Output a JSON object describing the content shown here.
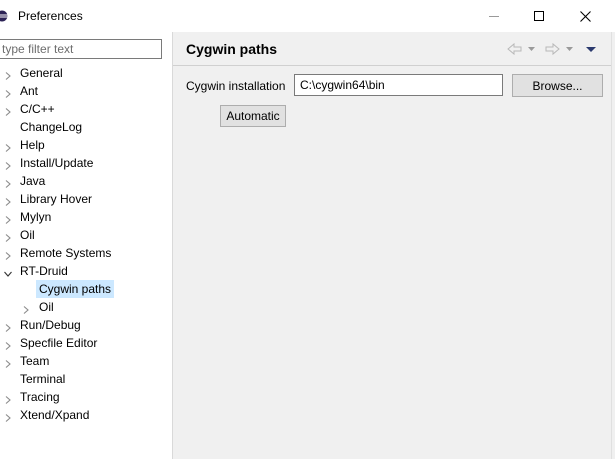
{
  "window": {
    "title": "Preferences",
    "minimize_icon": "minimize-icon",
    "maximize_icon": "maximize-icon",
    "close_icon": "close-icon"
  },
  "filter": {
    "placeholder": "type filter text",
    "value": ""
  },
  "tree": {
    "items": [
      {
        "label": "General",
        "expander": "collapsed",
        "selected": false
      },
      {
        "label": "Ant",
        "expander": "collapsed",
        "selected": false
      },
      {
        "label": "C/C++",
        "expander": "collapsed",
        "selected": false
      },
      {
        "label": "ChangeLog",
        "expander": "none",
        "selected": false
      },
      {
        "label": "Help",
        "expander": "collapsed",
        "selected": false
      },
      {
        "label": "Install/Update",
        "expander": "collapsed",
        "selected": false
      },
      {
        "label": "Java",
        "expander": "collapsed",
        "selected": false
      },
      {
        "label": "Library Hover",
        "expander": "collapsed",
        "selected": false
      },
      {
        "label": "Mylyn",
        "expander": "collapsed",
        "selected": false
      },
      {
        "label": "Oil",
        "expander": "collapsed",
        "selected": false
      },
      {
        "label": "Remote Systems",
        "expander": "collapsed",
        "selected": false
      },
      {
        "label": "RT-Druid",
        "expander": "expanded",
        "selected": false
      },
      {
        "label": "Cygwin paths",
        "expander": "none",
        "selected": true
      },
      {
        "label": "Oil",
        "expander": "collapsed",
        "selected": false
      },
      {
        "label": "Run/Debug",
        "expander": "collapsed",
        "selected": false
      },
      {
        "label": "Specfile Editor",
        "expander": "collapsed",
        "selected": false
      },
      {
        "label": "Team",
        "expander": "collapsed",
        "selected": false
      },
      {
        "label": "Terminal",
        "expander": "none",
        "selected": false
      },
      {
        "label": "Tracing",
        "expander": "collapsed",
        "selected": false
      },
      {
        "label": "Xtend/Xpand",
        "expander": "collapsed",
        "selected": false
      }
    ]
  },
  "page": {
    "title": "Cygwin paths",
    "nav_icons": [
      "back-arrow-icon",
      "back-dropdown-icon",
      "forward-arrow-icon",
      "forward-dropdown-icon",
      "view-menu-icon"
    ],
    "field_label": "Cygwin installation",
    "path_value": "C:\\cygwin64\\bin",
    "browse_label": "Browse...",
    "automatic_label": "Automatic"
  },
  "colors": {
    "selection": "#cce8ff",
    "panel_bg": "#f0f0f0",
    "button_bg": "#e1e1e1"
  }
}
